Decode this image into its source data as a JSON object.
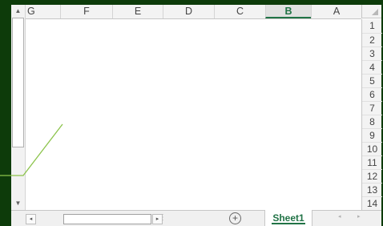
{
  "columns": [
    {
      "label": "G"
    },
    {
      "label": "F"
    },
    {
      "label": "E"
    },
    {
      "label": "D"
    },
    {
      "label": "C"
    },
    {
      "label": "B",
      "selected": true
    },
    {
      "label": "A"
    }
  ],
  "rows": [
    "1",
    "2",
    "3",
    "4",
    "5",
    "6",
    "7",
    "8",
    "9",
    "10",
    "11",
    "12",
    "13",
    "14"
  ],
  "sheet_tab": "Sheet1",
  "add_sheet_label": "+",
  "scroll_up": "▲",
  "scroll_down": "▼",
  "scroll_left": "◂",
  "scroll_right": "▸",
  "nav_prev": "◂",
  "nav_next": "▸",
  "dots": "⋮",
  "colors": {
    "accent": "#217346",
    "background": "#0d3b0a",
    "annotation_line": "#8bc34a"
  }
}
